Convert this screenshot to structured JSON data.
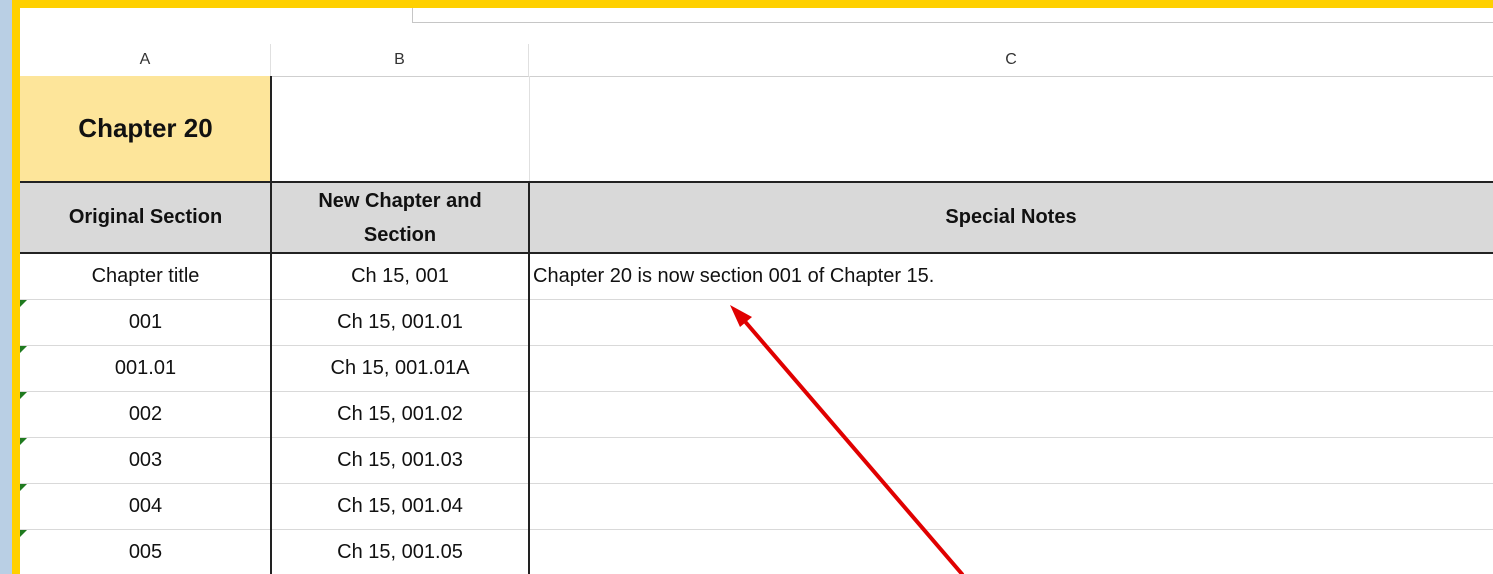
{
  "columns": [
    "A",
    "B",
    "C"
  ],
  "chapter_cell": "Chapter 20",
  "headers": {
    "original": "Original Section",
    "new_line1": "New Chapter and",
    "new_line2": "Section",
    "notes": "Special Notes"
  },
  "rows": [
    {
      "original": "Chapter title",
      "new": "Ch 15, 001",
      "notes": "Chapter 20 is now section 001 of Chapter 15."
    },
    {
      "original": "001",
      "new": "Ch 15, 001.01",
      "notes": ""
    },
    {
      "original": "001.01",
      "new": "Ch 15, 001.01A",
      "notes": ""
    },
    {
      "original": "002",
      "new": "Ch 15, 001.02",
      "notes": ""
    },
    {
      "original": "003",
      "new": "Ch 15, 001.03",
      "notes": ""
    },
    {
      "original": "004",
      "new": "Ch 15, 001.04",
      "notes": ""
    },
    {
      "original": "005",
      "new": "Ch 15, 001.05",
      "notes": ""
    }
  ],
  "colors": {
    "frame": "#ffd000",
    "chapter_fill": "#fde59a",
    "header_fill": "#d9d9d9",
    "arrow": "#e00000",
    "error_marker": "#1f7a1f"
  },
  "icons": {
    "arrow": "red-arrow-annotation",
    "marker": "error-triangle-icon"
  }
}
